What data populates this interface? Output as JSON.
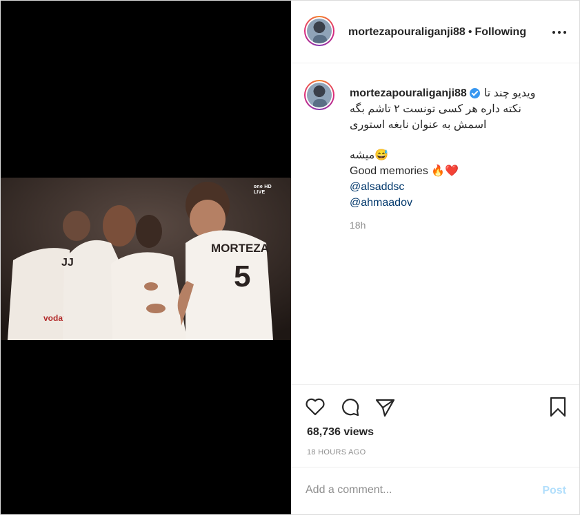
{
  "colors": {
    "accent": "#3897f0",
    "link": "#00376b",
    "muted": "#8e8e8e",
    "post_disabled": "#b2dffc"
  },
  "media": {
    "broadcaster": "one HD",
    "broadcaster_sub": "LIVE",
    "jersey_name": "MORTEZA",
    "jersey_number": "5",
    "sponsor": "vodafone"
  },
  "header": {
    "username": "mortezapouraliganji88",
    "separator": "•",
    "follow_status": "Following",
    "more_icon": "more-horizontal-icon"
  },
  "caption": {
    "username": "mortezapouraliganji88",
    "verified_icon": "verified-badge-icon",
    "line1": "ویدیو چند تا",
    "line2": "نکته داره هر کسی تونست ۲ تاشم بگه",
    "line3": "اسمش به عنوان نابغه استوری",
    "line4": "😅میشه",
    "line5": "Good memories 🔥❤️",
    "mention1": "@alsaddsc",
    "mention2": "@ahmaadov",
    "time": "18h"
  },
  "actions": {
    "icons": [
      "heart-icon",
      "comment-icon",
      "share-icon",
      "bookmark-icon"
    ],
    "views": "68,736 views",
    "time_ago": "18 HOURS AGO"
  },
  "comment": {
    "placeholder": "Add a comment...",
    "post_label": "Post"
  }
}
